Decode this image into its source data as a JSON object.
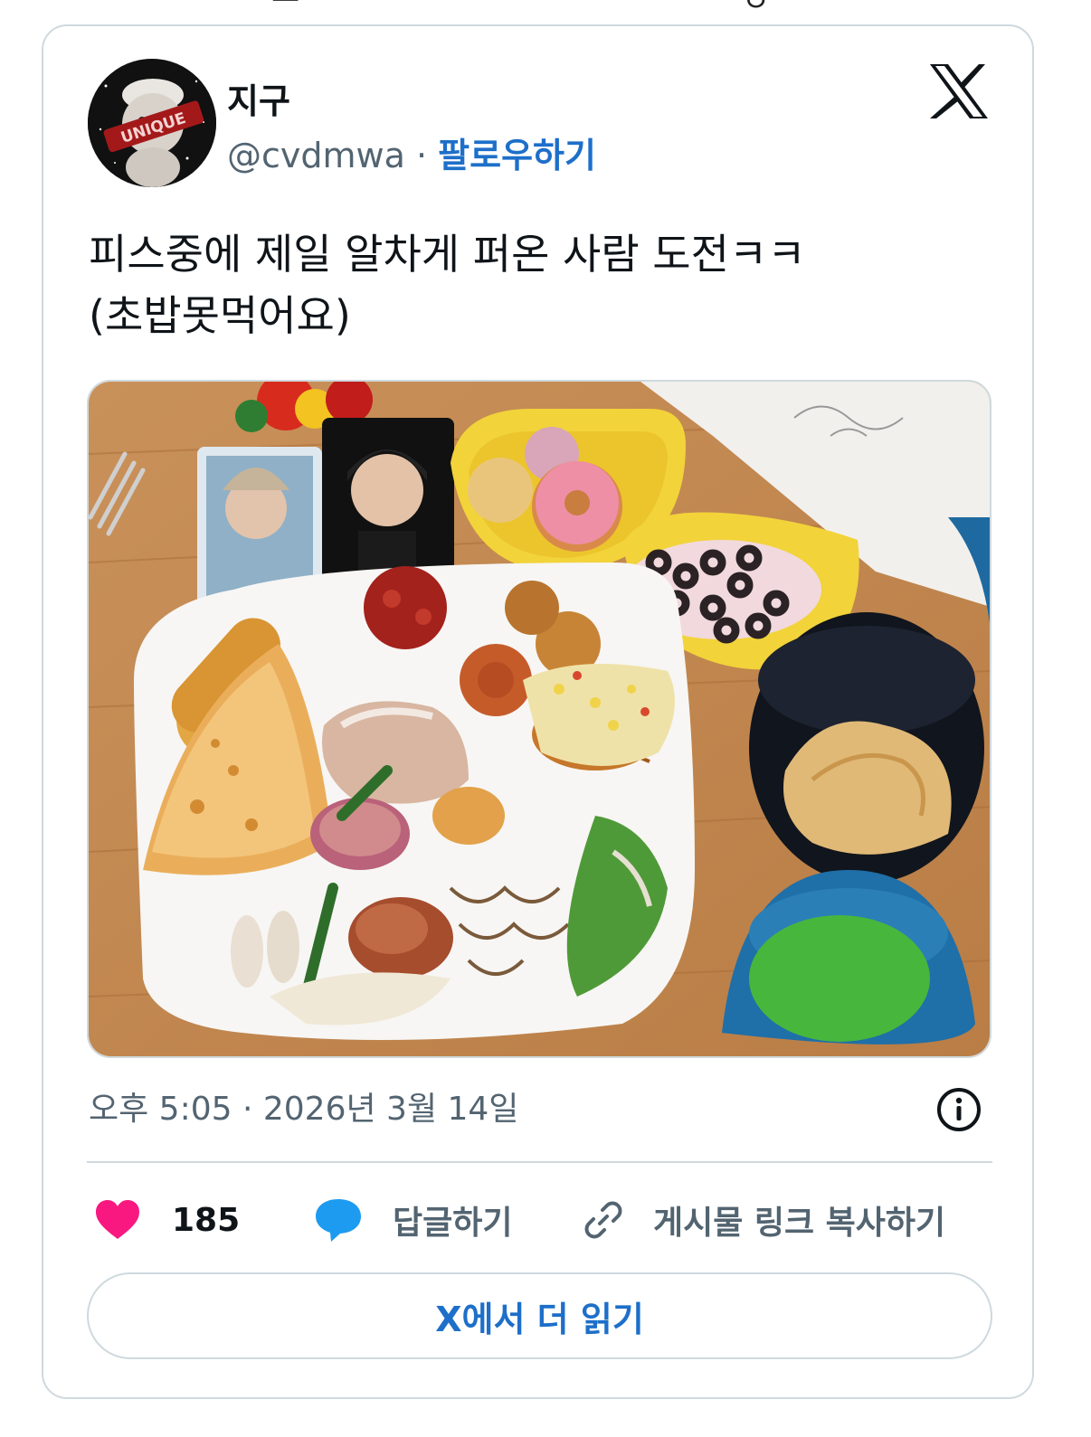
{
  "user": {
    "display_name": "지구",
    "handle": "@cvdmwa",
    "separator": "·",
    "follow_label": "팔로우하기"
  },
  "tweet": {
    "text_line1": "피스중에 제일 알차게 퍼온 사람 도전ㅋㅋ",
    "text_line2": "(초밥못먹어요)",
    "timestamp": "오후 5:05 · 2026년 3월 14일"
  },
  "actions": {
    "likes_count": "185",
    "reply_label": "답글하기",
    "copy_link_label": "게시물 링크 복사하기"
  },
  "read_more_label": "X에서 더 읽기",
  "icons": {
    "brand": "x-logo-icon",
    "like": "heart-icon",
    "reply": "speech-bubble-icon",
    "link": "link-icon",
    "info": "info-icon"
  },
  "colors": {
    "link_blue": "#1d6fc9",
    "heart_pink": "#f91880",
    "reply_blue": "#1d9bf0",
    "muted_text": "#536471",
    "border": "#cfd9de"
  }
}
